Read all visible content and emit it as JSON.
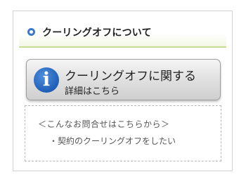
{
  "section": {
    "title": "クーリングオフについて"
  },
  "info_button": {
    "icon": "info-icon",
    "icon_glyph": "i",
    "main_label": "クーリングオフに関する",
    "sub_label": "詳細はこちら"
  },
  "inquiry": {
    "heading": "＜こんなお問合せはこちらから＞",
    "items": [
      {
        "label": "・契約のクーリングオフをしたい"
      }
    ]
  },
  "colors": {
    "accent_blue": "#3b7ac8",
    "header_underline": "#c7dd8f",
    "icon_blue": "#1f5fb8"
  }
}
